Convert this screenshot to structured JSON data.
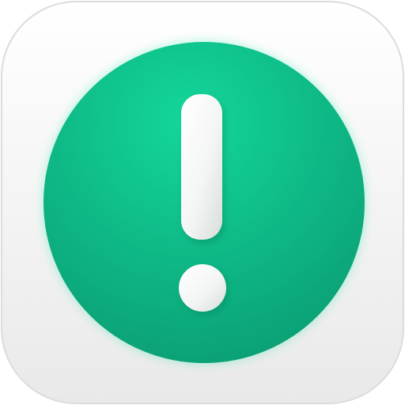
{
  "app_icon": {
    "icon": "exclamation-alert-icon",
    "colors": {
      "tile_top": "#ffffff",
      "tile_bottom": "#e9e9e9",
      "tile_edge": "#dcdcdc",
      "circle_top": "#13d79a",
      "circle_bottom": "#0a9a72",
      "circle_glow": "#28e8a8",
      "mark_fill": "#f4f6f5",
      "mark_shade": "#d7ddda"
    }
  }
}
